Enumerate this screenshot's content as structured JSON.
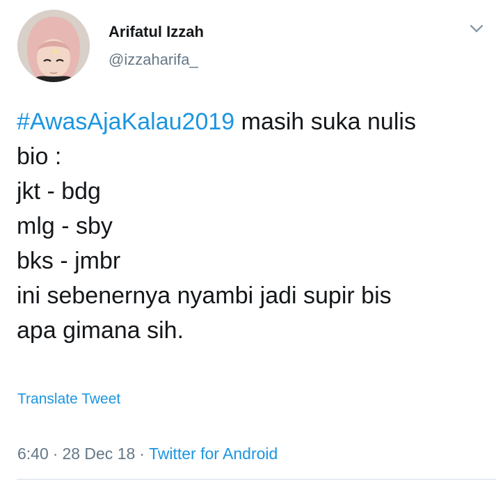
{
  "author": {
    "display_name": "Arifatul Izzah",
    "handle": "@izzaharifa_",
    "avatar_icon": "profile-photo"
  },
  "menu": {
    "icon": "chevron-down-icon"
  },
  "tweet": {
    "hashtag": "#AwasAjaKalau2019",
    "line1_rest": " masih suka nulis",
    "lines": [
      "bio :",
      "jkt - bdg",
      "mlg - sby",
      "bks - jmbr",
      "ini sebenernya nyambi jadi supir bis",
      "apa gimana sih."
    ]
  },
  "translate_label": "Translate Tweet",
  "meta": {
    "time": "6:40",
    "date": "28 Dec 18",
    "separator": "·",
    "source": "Twitter for Android"
  },
  "colors": {
    "link": "#1b95e0",
    "text": "#14171a",
    "muted": "#657786",
    "divider": "#e6ecf0"
  }
}
